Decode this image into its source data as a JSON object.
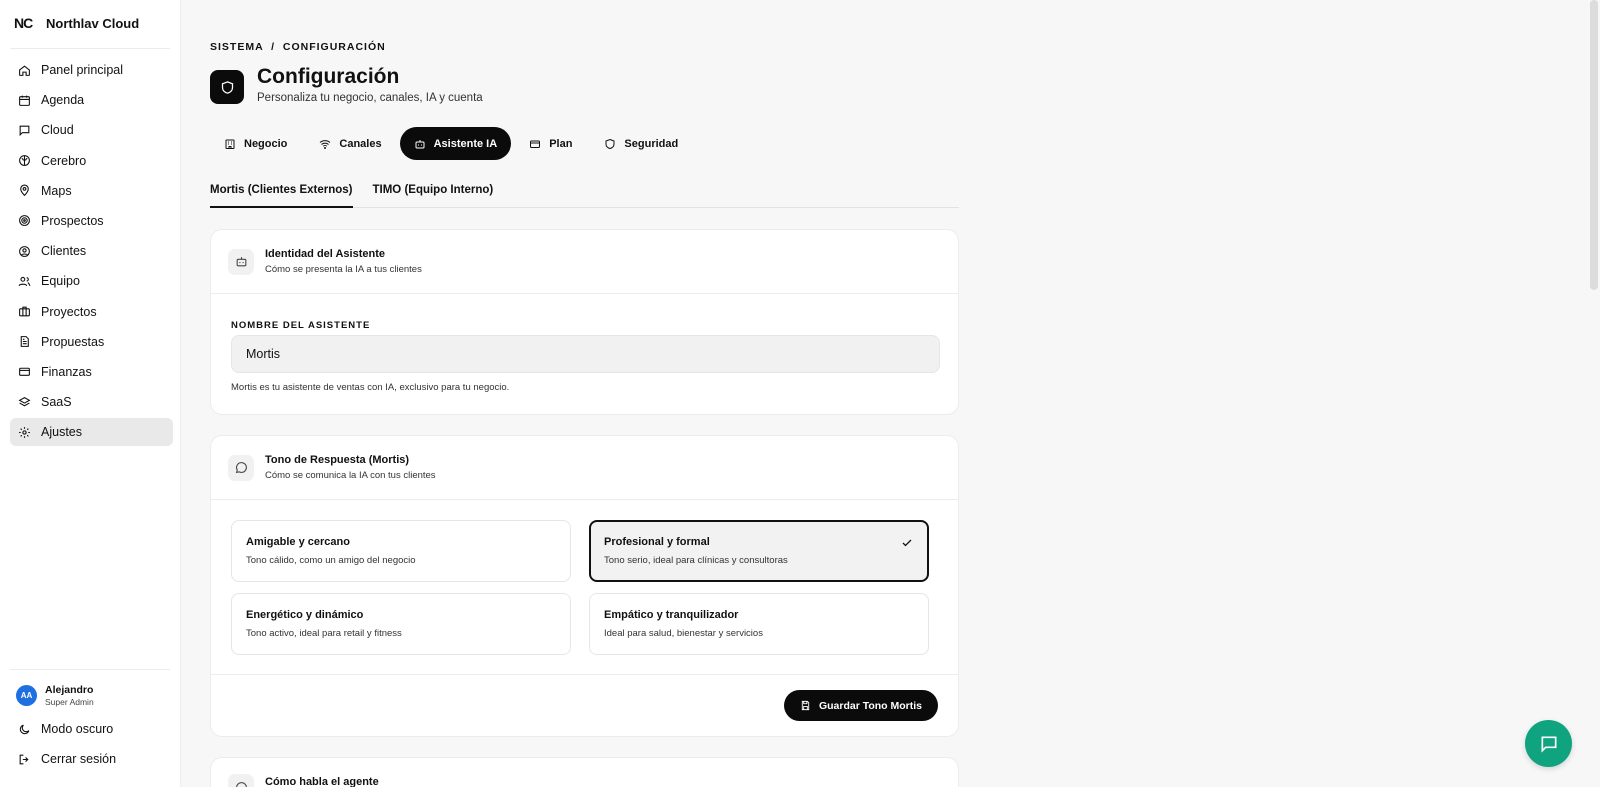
{
  "app": {
    "logo": "NC",
    "name": "Northlav Cloud"
  },
  "sidebar": {
    "items": [
      {
        "label": "Panel principal",
        "icon": "home-icon"
      },
      {
        "label": "Agenda",
        "icon": "calendar-icon"
      },
      {
        "label": "Cloud",
        "icon": "chat-icon"
      },
      {
        "label": "Cerebro",
        "icon": "brain-icon"
      },
      {
        "label": "Maps",
        "icon": "map-pin-icon"
      },
      {
        "label": "Prospectos",
        "icon": "target-icon"
      },
      {
        "label": "Clientes",
        "icon": "user-circle-icon"
      },
      {
        "label": "Equipo",
        "icon": "users-icon"
      },
      {
        "label": "Proyectos",
        "icon": "briefcase-icon"
      },
      {
        "label": "Propuestas",
        "icon": "document-icon"
      },
      {
        "label": "Finanzas",
        "icon": "credit-card-icon"
      },
      {
        "label": "SaaS",
        "icon": "layers-icon"
      },
      {
        "label": "Ajustes",
        "icon": "gear-icon",
        "active": true
      }
    ],
    "user": {
      "initials": "AA",
      "name": "Alejandro",
      "role": "Super Admin"
    },
    "dark_mode": "Modo oscuro",
    "logout": "Cerrar sesión"
  },
  "header": {
    "breadcrumb": "SISTEMA  /  CONFIGURACIÓN",
    "title": "Configuración",
    "subtitle": "Personaliza tu negocio, canales, IA y cuenta"
  },
  "tabs": [
    {
      "label": "Negocio",
      "icon": "building-icon"
    },
    {
      "label": "Canales",
      "icon": "wifi-icon"
    },
    {
      "label": "Asistente IA",
      "icon": "bot-icon",
      "active": true
    },
    {
      "label": "Plan",
      "icon": "credit-card-icon"
    },
    {
      "label": "Seguridad",
      "icon": "shield-icon"
    }
  ],
  "subtabs": [
    {
      "label": "Mortis (Clientes Externos)",
      "active": true
    },
    {
      "label": "TIMO (Equipo Interno)"
    }
  ],
  "identity_card": {
    "title": "Identidad del Asistente",
    "subtitle": "Cómo se presenta la IA a tus clientes",
    "field_label": "NOMBRE DEL ASISTENTE",
    "field_value": "Mortis",
    "help": "Mortis es tu asistente de ventas con IA, exclusivo para tu negocio."
  },
  "tone_card": {
    "title": "Tono de Respuesta (Mortis)",
    "subtitle": "Cómo se comunica la IA con tus clientes",
    "options": [
      {
        "title": "Amigable y cercano",
        "desc": "Tono cálido, como un amigo del negocio"
      },
      {
        "title": "Profesional y formal",
        "desc": "Tono serio, ideal para clínicas y consultoras",
        "selected": true
      },
      {
        "title": "Energético y dinámico",
        "desc": "Tono activo, ideal para retail y fitness"
      },
      {
        "title": "Empático y tranquilizador",
        "desc": "Ideal para salud, bienestar y servicios"
      }
    ],
    "save_label": "Guardar Tono Mortis"
  },
  "agent_card": {
    "title": "Cómo habla el agente"
  },
  "colors": {
    "accent": "#0b0b0b",
    "fab": "#10a37f",
    "avatar": "#1f6fe0"
  }
}
